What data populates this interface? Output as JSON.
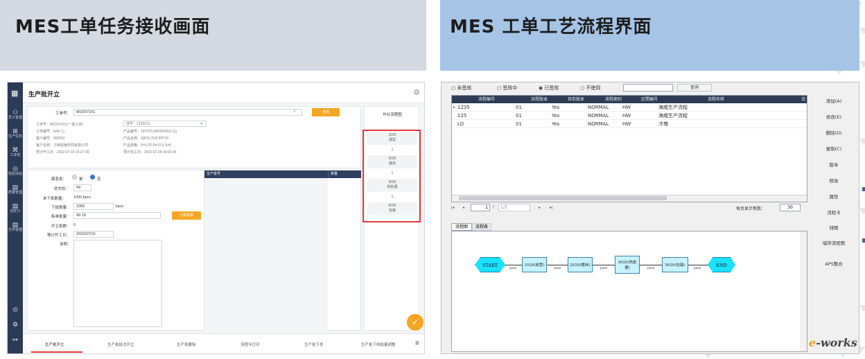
{
  "left_panel": {
    "header": "MES工单任务接收画面",
    "app": {
      "title": "生产批开立",
      "sidebar": [
        {
          "label": "员工管理",
          "icon": "person-group-icon"
        },
        {
          "label": "生产任务",
          "icon": "task-icon"
        },
        {
          "label": "工单查",
          "icon": "workorder-icon"
        },
        {
          "label": "检验派站",
          "icon": "inspect-icon"
        },
        {
          "label": "质量管理",
          "icon": "quality-icon"
        },
        {
          "label": "自定义",
          "icon": "custom-icon"
        },
        {
          "label": "文件管理",
          "icon": "file-icon"
        }
      ],
      "workorder_label": "工单号：",
      "workorder_value": "MO207161",
      "confirm_label": "查询",
      "info_left": [
        "工单号：MO207161(一般工单)",
        "订单编号：N/A( 1)",
        "客户编号：000002",
        "客户名称：江西铝板研究有限公司",
        "预计开工日：2022-07-16 15:27:09"
      ],
      "info_right": [
        "流号：1235(01)",
        "产品编号：1070761080020001 (1)",
        "产品名称：GB70-76文字8*20",
        "产品规格：P=3.25 D=12.5 S=6",
        "预计完工日：2022-07-26 00:00:00"
      ],
      "urgent_label": "紧急批：",
      "urgent_yes": "是",
      "urgent_no": "否",
      "priority_label": "优先权：",
      "priority_value": "99",
      "remain_label": "末下批数量：",
      "remain_value": "1000 kpcs",
      "batch_qty_label": "下批数量：",
      "batch_qty_value": "1000",
      "batch_qty_unit": "kpcs",
      "std_label": "标准批量：",
      "std_value": "49.18",
      "calc_button": "计算批数",
      "open_count_label": "开立批数：",
      "open_count_value": "0",
      "plan_date_label": "预计开工日：",
      "plan_date_value": "2022/07/16",
      "remark_label": "说明：",
      "table_headers": [
        "生产批号",
        "数量"
      ],
      "flow_title": "作业流程图",
      "flow_steps": [
        {
          "code": "1020",
          "name": "成型"
        },
        {
          "code": "2020",
          "name": "搓丝"
        },
        {
          "code": "3020",
          "name": "热处理"
        },
        {
          "code": "5020",
          "name": "包装"
        }
      ],
      "tabs": [
        "生产批开立",
        "生产批批次开立",
        "生产批删除",
        "流程卡打印",
        "生产批下发",
        "生产批下线批量调整"
      ],
      "active_tab": 0
    }
  },
  "right_panel": {
    "header": "MES 工单工艺流程界面",
    "app": {
      "radios": [
        {
          "label": "未签核",
          "checked": false
        },
        {
          "label": "签核中",
          "checked": false
        },
        {
          "label": "已签核",
          "checked": true
        },
        {
          "label": "不使用",
          "checked": false
        }
      ],
      "query_button": "查询",
      "columns": [
        "流程编号",
        "流程版本",
        "目前版本",
        "流程类别",
        "区間编号",
        "流程名称",
        "说"
      ],
      "rows": [
        [
          "1235",
          "01",
          "Yes",
          "NORMAL",
          "HW",
          "海威生产流程"
        ],
        [
          "125",
          "01",
          "Yes",
          "NORMAL",
          "HW",
          "海威生产流程"
        ],
        [
          "LD",
          "01",
          "Yes",
          "NORMAL",
          "HW",
          "冷墩"
        ]
      ],
      "side_buttons": [
        "添加(A)",
        "修改(E)",
        "删除(D)",
        "复制(C)",
        "版本",
        "核准",
        "属性",
        "流程卡"
      ],
      "side_buttons_lower": [
        "排图",
        "储存流程图",
        "APS整合"
      ],
      "pager": {
        "current": "1",
        "total": "1/3",
        "per_page_label": "每页显示笔数：",
        "per_page": "30"
      },
      "tabs": [
        "流程图",
        "流程表"
      ],
      "flow_nodes": [
        "1020(成型)",
        "2020(搓丝)",
        "3020(热处理)",
        "5020(包装)"
      ],
      "start_label": "START",
      "end_label": "END",
      "edge_label": "pass",
      "watermark": "e-works"
    }
  }
}
